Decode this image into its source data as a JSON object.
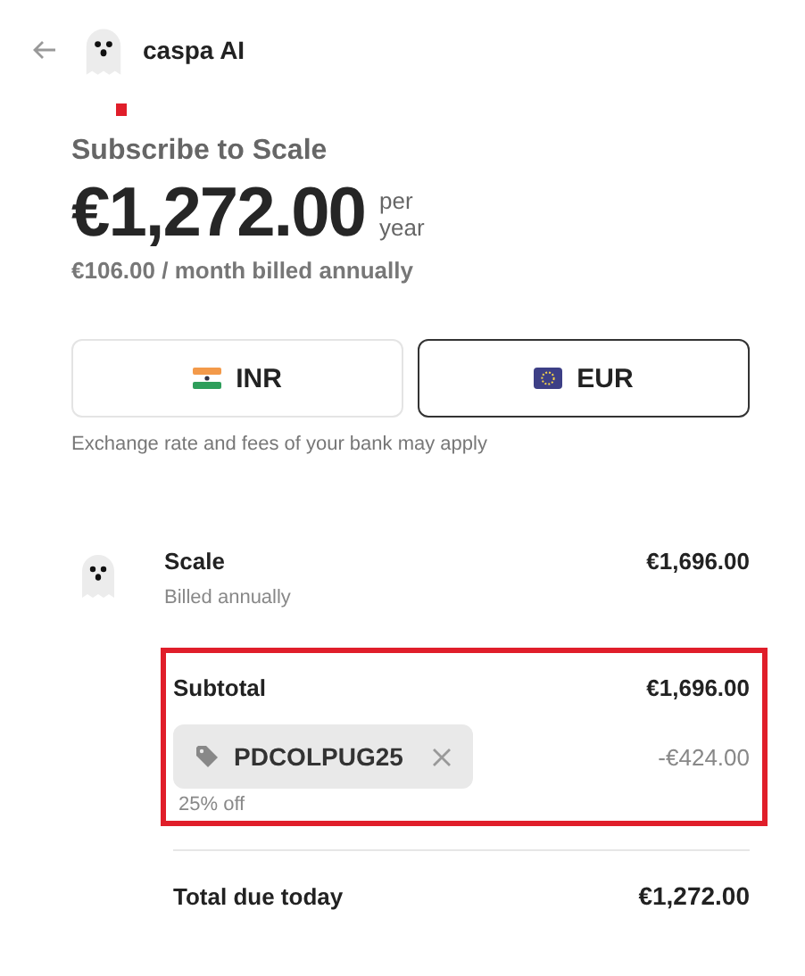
{
  "header": {
    "brand": "caspa AI"
  },
  "plan": {
    "title": "Subscribe to Scale",
    "price": "€1,272.00",
    "period_top": "per",
    "period_bottom": "year",
    "monthly": "€106.00 / month billed annually"
  },
  "currencies": [
    {
      "code": "INR",
      "kind": "india",
      "selected": false
    },
    {
      "code": "EUR",
      "kind": "europe",
      "selected": true
    }
  ],
  "currency_note": "Exchange rate and fees of your bank may apply",
  "line_item": {
    "name": "Scale",
    "billing": "Billed annually",
    "amount": "€1,696.00"
  },
  "summary": {
    "highlighted": true,
    "subtotal_label": "Subtotal",
    "subtotal": "€1,696.00",
    "coupon": "PDCOLPUG25",
    "discount": "-€424.00",
    "discount_note": "25% off"
  },
  "total": {
    "label": "Total due today",
    "amount": "€1,272.00"
  }
}
